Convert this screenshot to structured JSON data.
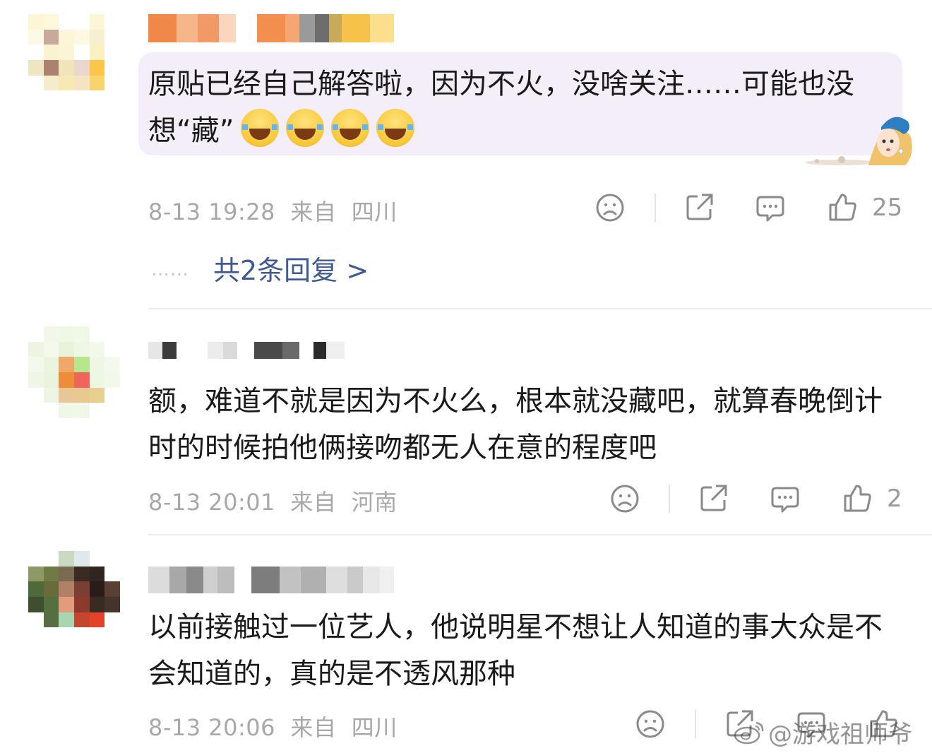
{
  "comments": [
    {
      "text": "原贴已经自己解答啦，因为不火，没啥关注……可能也没想“藏”",
      "emoji_count": 4,
      "date": "8-13 19:28",
      "from_label": "来自",
      "location": "四川",
      "likes": "25",
      "reply_link": {
        "dots": "……",
        "label": "共2条回复 >"
      }
    },
    {
      "text": "额，难道不就是因为不火么，根本就没藏吧，就算春晚倒计时的时候拍他俩接吻都无人在意的程度吧",
      "date": "8-13 20:01",
      "from_label": "来自",
      "location": "河南",
      "likes": "2"
    },
    {
      "text": "以前接触过一位艺人，他说明星不想让人知道的事大众是不会知道的，真的是不透风那种",
      "date": "8-13 20:06",
      "from_label": "来自",
      "location": "四川",
      "likes": ""
    }
  ],
  "icons": {
    "dislike": "sad-face-icon",
    "share": "share-icon",
    "comment": "comment-bubble-icon",
    "like": "thumbs-up-icon"
  },
  "colors": {
    "reply_link": "#3f5a94",
    "meta_text": "#a8a8a8",
    "bubble_bg": "#f3eef8"
  },
  "watermark": "@游戏祖师爷"
}
